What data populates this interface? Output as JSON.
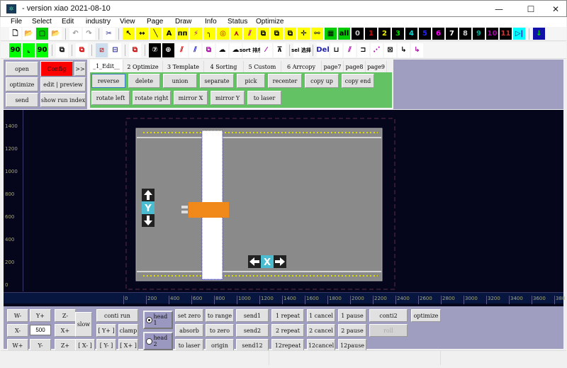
{
  "window": {
    "title": "- version xiao 2021-08-10",
    "minimize": "—",
    "maximize": "☐",
    "close": "✕"
  },
  "menu": [
    "File",
    "Select",
    "Edit",
    "industry",
    "View",
    "Page",
    "Draw",
    "Info",
    "Status",
    "Optimize"
  ],
  "toolbar1": [
    {
      "name": "new",
      "g": "🗋",
      "bg": "#fff",
      "fg": "#000"
    },
    {
      "name": "open-folder",
      "g": "📂",
      "bg": "#fff",
      "fg": "#b80"
    },
    {
      "name": "shape",
      "g": "▢",
      "bg": "#0c0",
      "fg": "#000"
    },
    {
      "name": "add-folder",
      "g": "📂",
      "bg": "#fff",
      "fg": "#b80"
    },
    {
      "sep": true
    },
    {
      "name": "undo",
      "g": "↶",
      "bg": "#fff",
      "fg": "#999"
    },
    {
      "name": "redo",
      "g": "↷",
      "bg": "#fff",
      "fg": "#999"
    },
    {
      "sep": true
    },
    {
      "name": "cut",
      "g": "✂",
      "bg": "#fff",
      "fg": "#228"
    },
    {
      "sep": true
    },
    {
      "name": "pointer",
      "g": "↖",
      "bg": "#ff0",
      "fg": "#000"
    },
    {
      "name": "measure",
      "g": "↔",
      "bg": "#ff0",
      "fg": "#000"
    },
    {
      "name": "line",
      "g": "╲",
      "bg": "#ff0",
      "fg": "#000"
    },
    {
      "name": "text",
      "g": "A",
      "bg": "#ff0",
      "fg": "#000"
    },
    {
      "name": "wave",
      "g": "ᴨᴨ",
      "bg": "#ff0",
      "fg": "#000"
    },
    {
      "name": "path",
      "g": "⚡",
      "bg": "#ff0",
      "fg": "#a0a"
    },
    {
      "name": "corner",
      "g": "╮",
      "bg": "#ff0",
      "fg": "#000"
    },
    {
      "name": "circle",
      "g": "◎",
      "bg": "#ff0",
      "fg": "#c00"
    },
    {
      "name": "angle",
      "g": "⋏",
      "bg": "#ff0",
      "fg": "#a00"
    },
    {
      "name": "diag",
      "g": "⫽",
      "bg": "#ff0",
      "fg": "#a0a"
    },
    {
      "name": "node1",
      "g": "⧉",
      "bg": "#ff0",
      "fg": "#000"
    },
    {
      "name": "node2",
      "g": "⧉",
      "bg": "#ff0",
      "fg": "#000"
    },
    {
      "name": "node3",
      "g": "⧉",
      "bg": "#ff0",
      "fg": "#000"
    },
    {
      "name": "move",
      "g": "✛",
      "bg": "#ff0",
      "fg": "#000"
    },
    {
      "name": "link",
      "g": "⚯",
      "bg": "#ff0",
      "fg": "#000"
    },
    {
      "name": "grid",
      "g": "▦",
      "bg": "#0c0",
      "fg": "#000"
    },
    {
      "name": "all",
      "g": "all",
      "bg": "#0c0",
      "fg": "#000"
    },
    {
      "name": "layer-0",
      "g": "0",
      "bg": "#000",
      "fg": "#ccc"
    },
    {
      "name": "layer-1",
      "g": "1",
      "bg": "#000",
      "fg": "#e00"
    },
    {
      "name": "layer-2",
      "g": "2",
      "bg": "#000",
      "fg": "#ee0"
    },
    {
      "name": "layer-3",
      "g": "3",
      "bg": "#000",
      "fg": "#0d0"
    },
    {
      "name": "layer-4",
      "g": "4",
      "bg": "#000",
      "fg": "#0dd"
    },
    {
      "name": "layer-5",
      "g": "5",
      "bg": "#000",
      "fg": "#22f"
    },
    {
      "name": "layer-6",
      "g": "6",
      "bg": "#000",
      "fg": "#f0f"
    },
    {
      "name": "layer-7",
      "g": "7",
      "bg": "#000",
      "fg": "#fff"
    },
    {
      "name": "layer-8",
      "g": "8",
      "bg": "#000",
      "fg": "#ccc"
    },
    {
      "name": "layer-9",
      "g": "9",
      "bg": "#000",
      "fg": "#0a9"
    },
    {
      "name": "layer-10",
      "g": "10",
      "bg": "#000",
      "fg": "#a0a"
    },
    {
      "name": "layer-11",
      "g": "11",
      "bg": "#000",
      "fg": "#c33"
    },
    {
      "name": "play-next",
      "g": "▷|",
      "bg": "#0ff",
      "fg": "#00a"
    },
    {
      "sep": true
    },
    {
      "name": "download",
      "g": "↓",
      "bg": "#11a",
      "fg": "#0d0"
    }
  ],
  "toolbar2": [
    {
      "name": "rotate-90-left",
      "g": "90",
      "bg": "#0f0",
      "fg": "#000"
    },
    {
      "name": "corner-down",
      "g": "⌞",
      "bg": "#0f0",
      "fg": "#000"
    },
    {
      "name": "rotate-90-right",
      "g": "90",
      "bg": "#0f0",
      "fg": "#000"
    },
    {
      "sep": true
    },
    {
      "name": "overlap",
      "g": "⧉",
      "bg": "#fff",
      "fg": "#000"
    },
    {
      "sep": true
    },
    {
      "name": "delete-node",
      "g": "⧉",
      "bg": "#fff",
      "fg": "#c00"
    },
    {
      "sep": true
    },
    {
      "name": "split",
      "g": "⧄",
      "bg": "#cde",
      "fg": "#c33"
    },
    {
      "name": "frame",
      "g": "⊟",
      "bg": "#fff",
      "fg": "#22a"
    },
    {
      "sep": true
    },
    {
      "name": "remove",
      "g": "⧉",
      "bg": "#fff",
      "fg": "#c00"
    },
    {
      "sep": true
    },
    {
      "name": "clock-7",
      "g": "⑦",
      "bg": "#000",
      "fg": "#fff"
    },
    {
      "name": "target-7",
      "g": "⊕",
      "bg": "#000",
      "fg": "#fff"
    },
    {
      "name": "lines-red",
      "g": "⫽",
      "bg": "#fff",
      "fg": "#c00"
    },
    {
      "name": "lines-blue",
      "g": "⫽",
      "bg": "#fff",
      "fg": "#22c"
    },
    {
      "name": "nodes",
      "g": "⧉",
      "bg": "#fff",
      "fg": "#a0a"
    },
    {
      "name": "cloud1",
      "g": "☁",
      "bg": "#fff",
      "fg": "#000"
    },
    {
      "name": "cloud2",
      "g": "☁",
      "bg": "#fff",
      "fg": "#000"
    },
    {
      "name": "sort",
      "g": "sort 排序",
      "bg": "#fff",
      "fg": "#000"
    },
    {
      "name": "slash",
      "g": "⁄",
      "bg": "#fff",
      "fg": "#a0a"
    },
    {
      "name": "align",
      "g": "⊼",
      "bg": "#fff",
      "fg": "#000"
    },
    {
      "sep": true
    },
    {
      "name": "select",
      "g": "sel 选择",
      "bg": "#fff",
      "fg": "#000"
    },
    {
      "sep": true
    },
    {
      "name": "del",
      "g": "Del",
      "bg": "#fff",
      "fg": "#22a"
    },
    {
      "name": "u-node",
      "g": "⊔",
      "bg": "#fff",
      "fg": "#000"
    },
    {
      "name": "zigzag",
      "g": "⫽",
      "bg": "#fff",
      "fg": "#a0a"
    },
    {
      "name": "bracket",
      "g": "⊐",
      "bg": "#fff",
      "fg": "#000"
    },
    {
      "name": "dots",
      "g": "⋰",
      "bg": "#fff",
      "fg": "#a0a"
    },
    {
      "name": "expand",
      "g": "⊠",
      "bg": "#fff",
      "fg": "#000"
    },
    {
      "name": "curve1",
      "g": "↳",
      "bg": "#fff",
      "fg": "#000"
    },
    {
      "name": "curve2",
      "g": "↳",
      "bg": "#fff",
      "fg": "#a0a"
    }
  ],
  "left_buttons": {
    "open": "open",
    "config": "Config",
    "more": ">>",
    "optimize": "optimize",
    "edit_preview": "edit | preview",
    "send": "send",
    "show_run_index": "show run index"
  },
  "tabs": [
    "_1_Edit__",
    "2 Optimize",
    "3 Template",
    "4 Sorting",
    "5 Custom",
    "6 Arrcopy",
    "page7",
    "page8",
    "page9"
  ],
  "edit_buttons": {
    "row1": [
      "reverse",
      "delete",
      "union",
      "separate",
      "pick",
      "recenter",
      "copy up",
      "copy end"
    ],
    "row2": [
      "rotate left",
      "rotate right",
      "mirror X",
      "mirror Y",
      "to laser"
    ]
  },
  "y_ruler": [
    "1400",
    "1200",
    "1000",
    "800",
    "600",
    "400",
    "200",
    "0"
  ],
  "x_ruler": [
    "0",
    "200",
    "400",
    "600",
    "800",
    "1000",
    "1200",
    "1400",
    "1600",
    "1800",
    "2000",
    "2200",
    "2400",
    "2600",
    "2800",
    "3000",
    "3200",
    "3400",
    "3600",
    "380"
  ],
  "machine": {
    "y_axis_label": "Y",
    "x_axis_label": "X"
  },
  "jog": {
    "w_minus": "W-",
    "y_plus": "Y+",
    "z_minus": "Z-",
    "x_minus": "X-",
    "step": "500",
    "x_plus": "X+",
    "w_plus": "W+",
    "y_minus": "Y-",
    "z_plus": "Z+",
    "slow": "slow",
    "conti_run": "conti run",
    "b_y_plus": "[ Y+ ]",
    "clamp": "clamp",
    "b_x_minus": "[ X- ]",
    "b_y_minus": "[ Y- ]",
    "b_x_plus": "[ X+ ]"
  },
  "heads": {
    "head1": "head 1",
    "head2": "head 2",
    "selected": "head 1"
  },
  "actions": [
    [
      "set zero",
      "to range",
      "send1",
      "1 repeat",
      "1 cancel",
      "1 pause",
      "conti2",
      "optimize"
    ],
    [
      "absorb",
      "to zero",
      "send2",
      "2 repeat",
      "2 cancel",
      "2 pause",
      "roll"
    ],
    [
      "to laser",
      "origin",
      "send12",
      "12repeat",
      "12cancel",
      "12pause"
    ]
  ]
}
